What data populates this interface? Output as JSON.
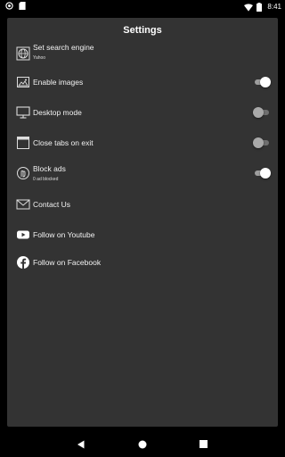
{
  "status": {
    "time": "8:41"
  },
  "settings": {
    "title": "Settings",
    "items": [
      {
        "label": "Set search engine",
        "sub": "Yahoo",
        "icon": "globe-icon"
      },
      {
        "label": "Enable images",
        "icon": "image-icon",
        "toggle": true
      },
      {
        "label": "Desktop mode",
        "icon": "monitor-icon",
        "toggle": false
      },
      {
        "label": "Close tabs on exit",
        "icon": "window-icon",
        "toggle": false
      },
      {
        "label": "Block ads",
        "sub": "0 ad blocked",
        "icon": "ad-block-icon",
        "toggle": true
      },
      {
        "label": "Contact Us",
        "icon": "mail-icon"
      },
      {
        "label": "Follow on Youtube",
        "icon": "youtube-icon"
      },
      {
        "label": "Follow on Facebook",
        "icon": "facebook-icon"
      }
    ]
  },
  "nav": {
    "back": "back-icon",
    "home": "home-icon",
    "recents": "recents-icon"
  }
}
